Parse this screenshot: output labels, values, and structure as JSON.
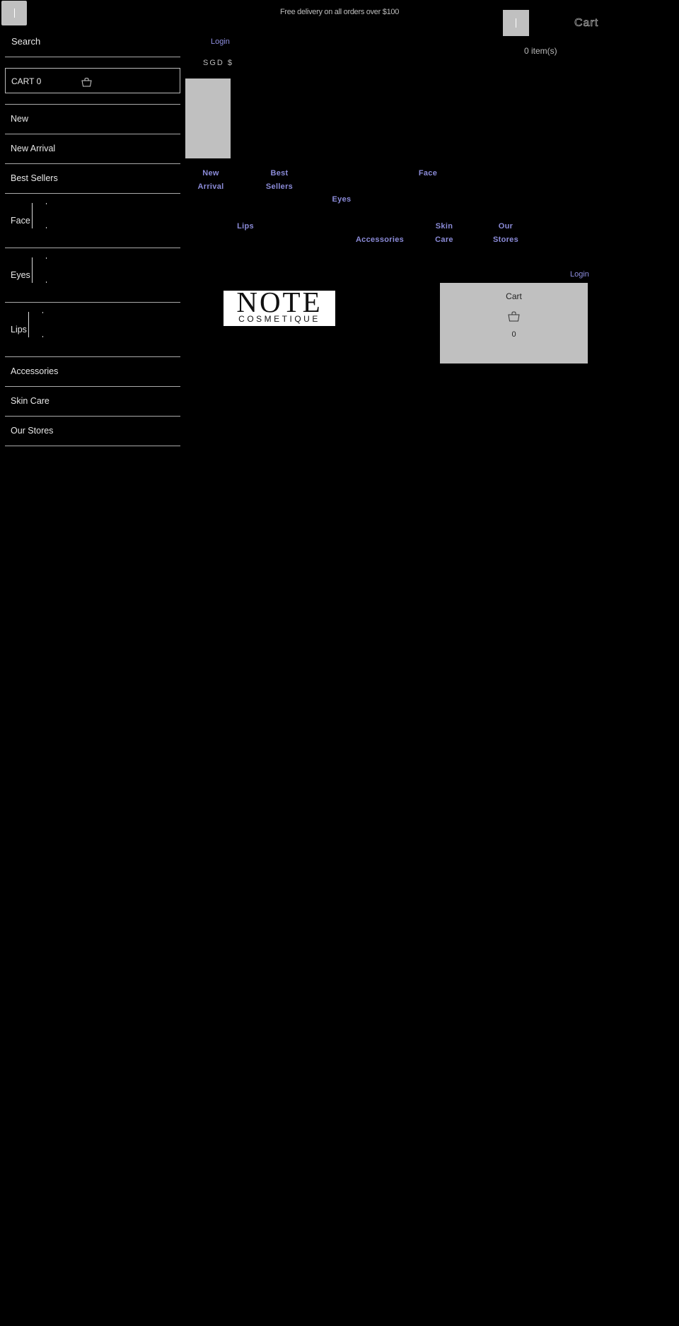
{
  "header": {
    "promo_text": "Free delivery on all orders over $100",
    "cart_label": "Cart",
    "items_count_text": "0 item(s)",
    "login_label": "Login",
    "currency": "SGD $"
  },
  "sidebar": {
    "search_label": "Search",
    "cart_label": "CART 0",
    "items": [
      {
        "label": "New"
      },
      {
        "label": "New Arrival"
      },
      {
        "label": "Best Sellers"
      },
      {
        "label": "Face"
      },
      {
        "label": "Eyes"
      },
      {
        "label": "Lips"
      },
      {
        "label": "Accessories"
      },
      {
        "label": "Skin Care"
      },
      {
        "label": "Our Stores"
      }
    ]
  },
  "nav_links": {
    "new_arrival": "New Arrival",
    "best_sellers": "Best Sellers",
    "face": "Face",
    "eyes": "Eyes",
    "lips": "Lips",
    "accessories": "Accessories",
    "skin_care": "Skin Care",
    "our_stores": "Our Stores"
  },
  "brand": {
    "logo_main": "NOTE",
    "logo_sub": "COSMETIQUE"
  },
  "cart_panel": {
    "login_label": "Login",
    "title": "Cart",
    "count": "0"
  },
  "colors": {
    "background": "#000000",
    "link": "#8b8bd8",
    "placeholder_gray": "#c0c0c0"
  }
}
